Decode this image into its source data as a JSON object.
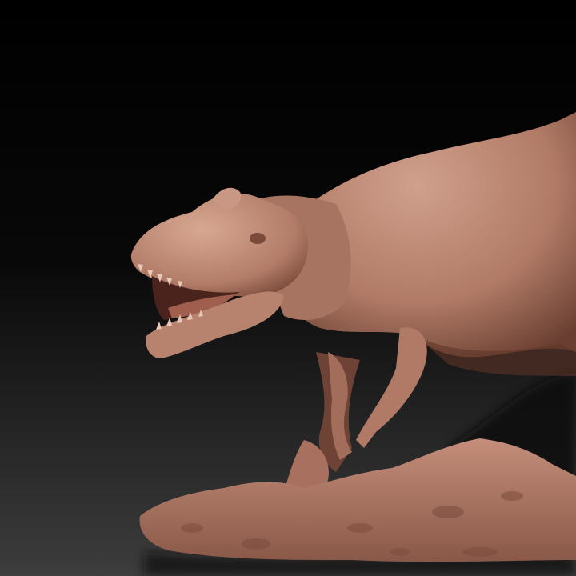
{
  "image": {
    "subject": "",
    "colors": {
      "background_top": "#000000",
      "background_bottom": "#3d3d3d",
      "clay": "#b8826f",
      "clay_shadow": "#6e4234",
      "clay_highlight": "#d4a491",
      "ground_shadow": "#0c0c0c"
    }
  }
}
